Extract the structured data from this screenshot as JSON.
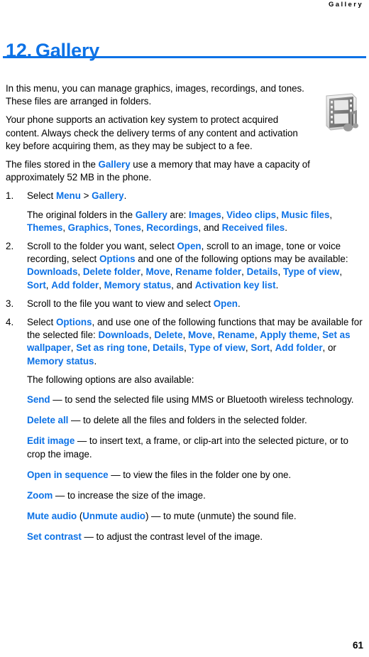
{
  "header": {
    "running_title": "Gallery"
  },
  "title": {
    "number": "12.",
    "text": "Gallery"
  },
  "intro": {
    "p1": "In this menu, you can manage graphics, images, recordings, and tones. These files are arranged in folders.",
    "p2": "Your phone supports an activation key system to protect acquired content. Always check the delivery terms of any content and activation key before acquiring them, as they may be subject to a fee.",
    "p3_a": "The files stored in the ",
    "p3_link": "Gallery",
    "p3_b": " use a memory that may have a capacity of approximately 52 MB in the phone."
  },
  "icon": {
    "name": "gallery-film-music-icon"
  },
  "steps": {
    "step1": {
      "lead": "Select ",
      "menu": "Menu",
      "gt": " > ",
      "gallery": "Gallery",
      "period": ".",
      "sub_a": "The original folders in the ",
      "sub_gallery": "Gallery",
      "sub_b": " are: ",
      "folders": [
        "Images",
        "Video clips",
        "Music files",
        "Themes",
        "Graphics",
        "Tones",
        "Recordings"
      ],
      "sub_and": ", and ",
      "folder_last": "Received files",
      "sub_end": "."
    },
    "step2": {
      "text_a": "Scroll to the folder you want, select ",
      "open": "Open",
      "text_b": ", scroll to an image, tone or voice recording, select ",
      "options": "Options",
      "text_c": " and one of the following options may be available: ",
      "items": [
        "Downloads",
        "Delete folder",
        "Move",
        "Rename folder",
        "Details",
        "Type of view",
        "Sort",
        "Add folder",
        "Memory status"
      ],
      "and": ", and ",
      "item_last": "Activation key list",
      "end": "."
    },
    "step3": {
      "text_a": "Scroll to the file you want to view and select ",
      "open": "Open",
      "end": "."
    },
    "step4": {
      "text_a": "Select ",
      "options": "Options",
      "text_b": ", and use one of the following functions that may be available for the selected file: ",
      "items": [
        "Downloads",
        "Delete",
        "Move",
        "Rename",
        "Apply theme",
        "Set as wallpaper",
        "Set as ring tone",
        "Details",
        "Type of view",
        "Sort",
        "Add folder"
      ],
      "or": ", or ",
      "item_last": "Memory status",
      "end": ".",
      "sub": "The following options are also available:"
    }
  },
  "options": [
    {
      "term": "Send",
      "dash": " — ",
      "desc": "to send the selected file using MMS or Bluetooth wireless technology."
    },
    {
      "term": "Delete all",
      "dash": " — ",
      "desc": "to delete all the files and folders in the selected folder."
    },
    {
      "term": "Edit image",
      "dash": " — ",
      "desc": "to insert text, a frame, or clip-art into the selected picture, or to crop the image."
    },
    {
      "term": "Open in sequence",
      "dash": " — ",
      "desc": "to view the files in the folder one by one."
    },
    {
      "term": "Zoom",
      "dash": " — ",
      "desc": "to increase the size of the image."
    },
    {
      "term": "Mute audio",
      "paren_open": " (",
      "term2": "Unmute audio",
      "paren_close": ")",
      "dash": " — ",
      "desc": "to mute (unmute) the sound file."
    },
    {
      "term": "Set contrast",
      "dash": " — ",
      "desc": "to adjust the contrast level of the image."
    }
  ],
  "footer": {
    "page_number": "61"
  },
  "colors": {
    "accent_blue": "#0d72e6",
    "text_black": "#000000",
    "page_background": "#ffffff"
  }
}
